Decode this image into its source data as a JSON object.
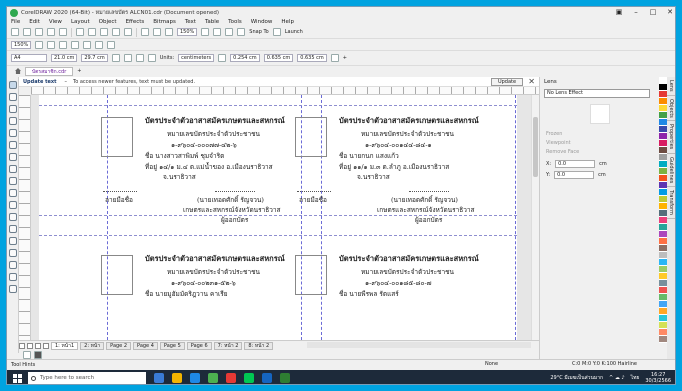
{
  "window": {
    "title": "CorelDRAW 2020 (64-Bit) - หมายเลขบัตร ALCN01.cdr (Document opened)",
    "controls": [
      "▣",
      "–",
      "□",
      "✕"
    ]
  },
  "menu": [
    "File",
    "Edit",
    "View",
    "Layout",
    "Object",
    "Effects",
    "Bitmaps",
    "Text",
    "Table",
    "Tools",
    "Window",
    "Help"
  ],
  "toolbar1": {
    "zoom": "150%",
    "snap_label": "Snap To",
    "launch_label": "Launch"
  },
  "toolbar2": {
    "zoom": "150%"
  },
  "toolbar3": {
    "page_size": "A4",
    "width": "21.0 cm",
    "height": "29.7 cm",
    "units_label": "Units:",
    "units_value": "centimeters",
    "nudge": "0.254 cm",
    "dup_x": "0.635 cm",
    "dup_y": "0.635 cm"
  },
  "document": {
    "tab_label": "บัตรสมาชิก.cdr"
  },
  "alert": {
    "title": "Update text",
    "message": "To access newer features, text must be updated.",
    "update_button": "Update"
  },
  "cards": [
    {
      "title": "บัตรประจำตัวอาสาสมัครเกษตรและสหกรณ์",
      "line1": "หมายเลขบัตรประจำตัวประชาชน",
      "line2": "๑-๙๖๐๔-๐๐๐๗๗-๔๒-๖",
      "line3": "ชื่อ นางสาวสาพิมพ์ ชุมจำริต",
      "line4": "ที่อยู่ ๑๔/๑ ม.๔ ต.แม่น้ำของ อ.เมืองนราธิวาส",
      "line5": "จ.นราธิวาส",
      "sign_left": "ลายมือชื่อ",
      "issuer_name": "(นายเทอดศักดิ์ รัญจวน)",
      "issuer_role": "เกษตรและสหกรณ์จังหวัดนราธิวาส",
      "issuer_title": "ผู้ออกบัตร"
    },
    {
      "title": "บัตรประจำตัวอาสาสมัครเกษตรและสหกรณ์",
      "line1": "หมายเลขบัตรประจำตัวประชาชน",
      "line2": "๑-๙๖๐๔-๐๐๑๔๔-๘๔-๑",
      "line3": "ชื่อ นายกนก แสงแก้ว",
      "line4": "ที่อยู่ ๑๑/๑ ม.๓ ต.ลำภู อ.เมืองนราธิวาส",
      "line5": "จ.นราธิวาส",
      "sign_left": "ลายมือชื่อ",
      "issuer_name": "(นายเทอดศักดิ์ รัญจวน)",
      "issuer_role": "เกษตรและสหกรณ์จังหวัดนราธิวาส",
      "issuer_title": "ผู้ออกบัตร"
    },
    {
      "title": "บัตรประจำตัวอาสาสมัครเกษตรและสหกรณ์",
      "line1": "หมายเลขบัตรประจำตัวประชาชน",
      "line2": "๑-๙๖๐๔-๐๐๒๓๑-๕๒-๖",
      "line3": "ชื่อ นายมูฮัมมัดริฎวาน คาเรีย",
      "line4": "",
      "line5": "",
      "sign_left": "",
      "issuer_name": "",
      "issuer_role": "",
      "issuer_title": ""
    },
    {
      "title": "บัตรประจำตัวอาสาสมัครเกษตรและสหกรณ์",
      "line1": "หมายเลขบัตรประจำตัวประชาชน",
      "line2": "๑-๙๖๐๔-๐๐๑๘๕-๘๐-๗",
      "line3": "ชื่อ นายพีรพล รัตแสร์",
      "line4": "",
      "line5": "",
      "sign_left": "",
      "issuer_name": "",
      "issuer_role": "",
      "issuer_title": ""
    }
  ],
  "page_tabs": [
    "1: หน้า1",
    "2: หน้า",
    "Page 2",
    "Page 4",
    "Page 5",
    "Page 6",
    "7: หน้า 2",
    "8: หน้า 2"
  ],
  "status": {
    "hints": "Tool Hints",
    "fill": "None",
    "outline": "C:0 M:0 Y:0 K:100 Hairline"
  },
  "docker": {
    "title": "Lens",
    "lens_select": "No Lens Effect",
    "checks": [
      "Frozen",
      "Viewpoint",
      "Remove Face"
    ],
    "x_label": "X:",
    "x_value": "0.0",
    "y_label": "Y:",
    "y_value": "0.0",
    "unit": "cm"
  },
  "right_tabs": [
    "Lens",
    "Objects",
    "Properties",
    "Guidelines",
    "Transform"
  ],
  "palette_colors": [
    "#ffffff",
    "#000000",
    "#e53935",
    "#fb8c00",
    "#fdd835",
    "#43a047",
    "#1e88e5",
    "#3949ab",
    "#8e24aa",
    "#d81b60",
    "#6d4c41",
    "#9e9e9e",
    "#00acc1",
    "#7cb342",
    "#f4511e",
    "#5e35b1",
    "#039be5",
    "#c0ca33",
    "#ffb300",
    "#546e7a",
    "#ec407a",
    "#26a69a",
    "#ab47bc",
    "#ff7043",
    "#8d6e63",
    "#bdbdbd",
    "#29b6f6",
    "#9ccc65",
    "#ffca28",
    "#78909c",
    "#ef5350",
    "#66bb6a",
    "#42a5f5",
    "#ffa726",
    "#26c6da",
    "#d4e157",
    "#ff8a65",
    "#a1887f"
  ],
  "taskbar": {
    "search_placeholder": "Type here to search",
    "weather": "29°C มีเมฆเป็นส่วนมาก",
    "lang": "ไทย",
    "time": "16:27",
    "date": "30/3/2566"
  }
}
